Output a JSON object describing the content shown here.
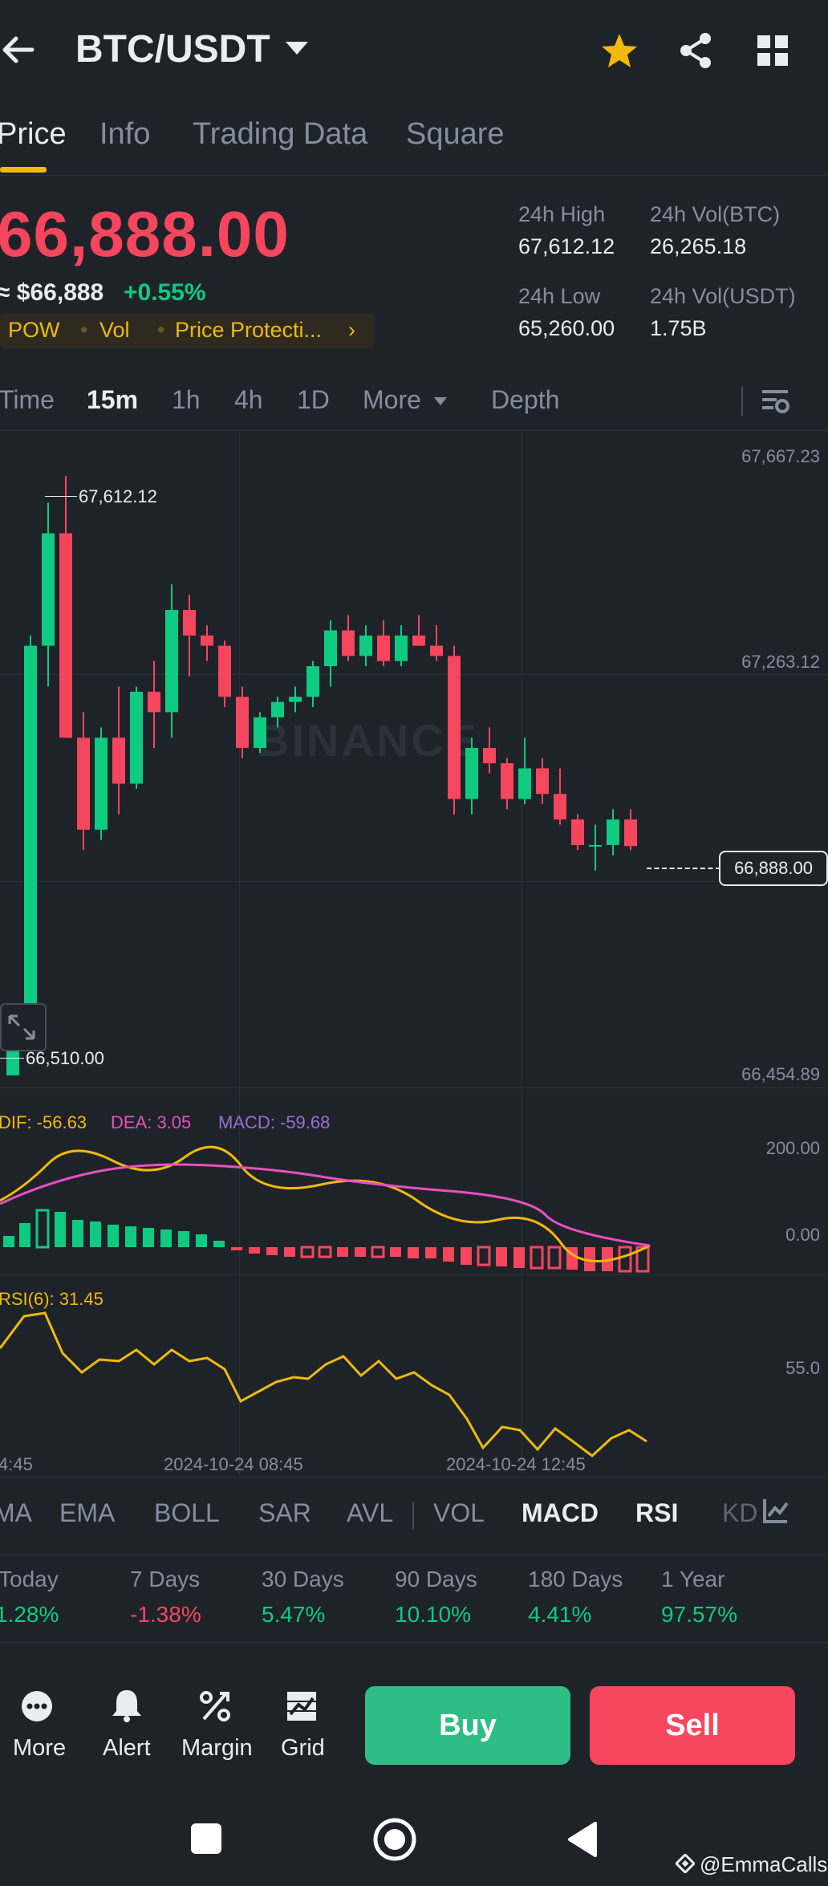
{
  "header": {
    "title": "BTC/USDT"
  },
  "tabs": [
    "Price",
    "Info",
    "Trading Data",
    "Square"
  ],
  "ticker": {
    "price": "66,888.00",
    "usd": "≈ $66,888",
    "change": "+0.55%",
    "tags": [
      "POW",
      "Vol",
      "Price Protecti..."
    ],
    "stats": {
      "high_label": "24h High",
      "high": "67,612.12",
      "low_label": "24h Low",
      "low": "65,260.00",
      "vol_btc_label": "24h Vol(BTC)",
      "vol_btc": "26,265.18",
      "vol_usdt_label": "24h Vol(USDT)",
      "vol_usdt": "1.75B"
    }
  },
  "timeframes": [
    "Time",
    "15m",
    "1h",
    "4h",
    "1D",
    "More",
    "Depth"
  ],
  "chart": {
    "y_labels": [
      "67,667.23",
      "67,263.12",
      "66,454.89"
    ],
    "current_price": "66,888.00",
    "high_marker": "67,612.12",
    "low_marker": "66,510.00",
    "watermark": "BINANCE",
    "x_labels": [
      "4:45",
      "2024-10-24 08:45",
      "2024-10-24 12:45"
    ]
  },
  "macd": {
    "dif": "DIF: -56.63",
    "dea": "DEA: 3.05",
    "macd": "MACD: -59.68",
    "y_labels": [
      "200.00",
      "0.00"
    ]
  },
  "rsi": {
    "label": "RSI(6): 31.45",
    "y_label": "55.0"
  },
  "indicators": [
    "MA",
    "EMA",
    "BOLL",
    "SAR",
    "AVL",
    "VOL",
    "MACD",
    "RSI",
    "KD"
  ],
  "performance": [
    {
      "label": "Today",
      "value": "1.28%"
    },
    {
      "label": "7 Days",
      "value": "-1.38%"
    },
    {
      "label": "30 Days",
      "value": "5.47%"
    },
    {
      "label": "90 Days",
      "value": "10.10%"
    },
    {
      "label": "180 Days",
      "value": "4.41%"
    },
    {
      "label": "1 Year",
      "value": "97.57%"
    }
  ],
  "actions": [
    "More",
    "Alert",
    "Margin",
    "Grid"
  ],
  "buy_label": "Buy",
  "sell_label": "Sell",
  "watermark_user": "@EmmaCalls",
  "colors": {
    "up": "#0ecb81",
    "down": "#f6465d",
    "accent": "#f0b90b",
    "bg": "#1e2329"
  },
  "chart_data": {
    "type": "candlestick",
    "interval": "15m",
    "ylim": [
      66454.89,
      67667.23
    ],
    "candles": [
      {
        "o": 66400,
        "h": 66540,
        "l": 66380,
        "c": 66520
      },
      {
        "o": 66520,
        "h": 67300,
        "l": 66510,
        "c": 67280
      },
      {
        "o": 67280,
        "h": 67560,
        "l": 67200,
        "c": 67500
      },
      {
        "o": 67500,
        "h": 67612,
        "l": 67150,
        "c": 67100
      },
      {
        "o": 67100,
        "h": 67150,
        "l": 66880,
        "c": 66920
      },
      {
        "o": 66920,
        "h": 67120,
        "l": 66900,
        "c": 67100
      },
      {
        "o": 67100,
        "h": 67200,
        "l": 66950,
        "c": 67010
      },
      {
        "o": 67010,
        "h": 67200,
        "l": 67000,
        "c": 67190
      },
      {
        "o": 67190,
        "h": 67250,
        "l": 67080,
        "c": 67150
      },
      {
        "o": 67150,
        "h": 67400,
        "l": 67100,
        "c": 67350
      },
      {
        "o": 67350,
        "h": 67380,
        "l": 67220,
        "c": 67300
      },
      {
        "o": 67300,
        "h": 67320,
        "l": 67250,
        "c": 67280
      },
      {
        "o": 67280,
        "h": 67290,
        "l": 67160,
        "c": 67180
      },
      {
        "o": 67180,
        "h": 67200,
        "l": 67060,
        "c": 67080
      },
      {
        "o": 67080,
        "h": 67150,
        "l": 67070,
        "c": 67140
      },
      {
        "o": 67140,
        "h": 67180,
        "l": 67120,
        "c": 67170
      },
      {
        "o": 67170,
        "h": 67200,
        "l": 67150,
        "c": 67180
      },
      {
        "o": 67180,
        "h": 67250,
        "l": 67160,
        "c": 67240
      },
      {
        "o": 67240,
        "h": 67330,
        "l": 67200,
        "c": 67310
      },
      {
        "o": 67310,
        "h": 67340,
        "l": 67250,
        "c": 67260
      },
      {
        "o": 67260,
        "h": 67320,
        "l": 67240,
        "c": 67300
      },
      {
        "o": 67300,
        "h": 67330,
        "l": 67240,
        "c": 67250
      },
      {
        "o": 67250,
        "h": 67320,
        "l": 67240,
        "c": 67300
      },
      {
        "o": 67300,
        "h": 67340,
        "l": 67280,
        "c": 67280
      },
      {
        "o": 67280,
        "h": 67320,
        "l": 67250,
        "c": 67260
      },
      {
        "o": 67260,
        "h": 67280,
        "l": 66950,
        "c": 66980
      },
      {
        "o": 66980,
        "h": 67100,
        "l": 66950,
        "c": 67080
      },
      {
        "o": 67080,
        "h": 67120,
        "l": 67030,
        "c": 67050
      },
      {
        "o": 67050,
        "h": 67060,
        "l": 66960,
        "c": 66980
      },
      {
        "o": 66980,
        "h": 67100,
        "l": 66970,
        "c": 67040
      },
      {
        "o": 67040,
        "h": 67060,
        "l": 66970,
        "c": 66990
      },
      {
        "o": 66990,
        "h": 67040,
        "l": 66930,
        "c": 66940
      },
      {
        "o": 66940,
        "h": 66950,
        "l": 66880,
        "c": 66890
      },
      {
        "o": 66890,
        "h": 66930,
        "l": 66840,
        "c": 66890
      },
      {
        "o": 66890,
        "h": 66960,
        "l": 66870,
        "c": 66940
      },
      {
        "o": 66940,
        "h": 66960,
        "l": 66880,
        "c": 66888
      }
    ]
  }
}
